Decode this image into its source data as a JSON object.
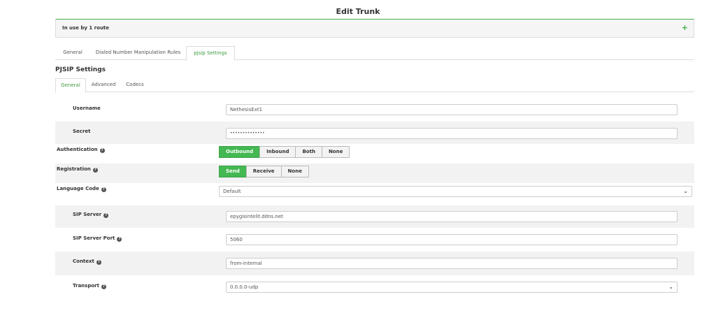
{
  "page_title": "Edit Trunk",
  "route_panel": {
    "label": "In use by 1 route",
    "expand_symbol": "+"
  },
  "main_tabs": [
    {
      "label": "General"
    },
    {
      "label": "Dialed Number Manipulation Rules"
    },
    {
      "label": "pjsip Settings",
      "active": true
    }
  ],
  "section_title": "PJSIP Settings",
  "sub_tabs": [
    {
      "label": "General",
      "active": true
    },
    {
      "label": "Advanced"
    },
    {
      "label": "Codecs"
    }
  ],
  "fields": {
    "username": {
      "label": "Username",
      "value": "NethesisExt1"
    },
    "secret": {
      "label": "Secret",
      "value": "••••••••••••••"
    },
    "authentication": {
      "label": "Authentication",
      "options": [
        "Outbound",
        "Inbound",
        "Both",
        "None"
      ],
      "selected": "Outbound"
    },
    "registration": {
      "label": "Registration",
      "options": [
        "Send",
        "Receive",
        "None"
      ],
      "selected": "Send"
    },
    "language_code": {
      "label": "Language Code",
      "value": "Default"
    },
    "sip_server": {
      "label": "SIP Server",
      "value": "epygisintelit.ddns.net"
    },
    "sip_server_port": {
      "label": "SIP Server Port",
      "value": "5060"
    },
    "context": {
      "label": "Context",
      "value": "from-internal"
    },
    "transport": {
      "label": "Transport",
      "value": "0.0.0.0-udp"
    }
  },
  "icons": {
    "help": "question-circle-icon",
    "caret": "chevron-down-icon",
    "help_glyph": "?",
    "caret_glyph": "⌄"
  },
  "colors": {
    "accent": "#44b852",
    "tab_active_text": "#3a9a3e",
    "panel_border": "#4cae4c"
  }
}
